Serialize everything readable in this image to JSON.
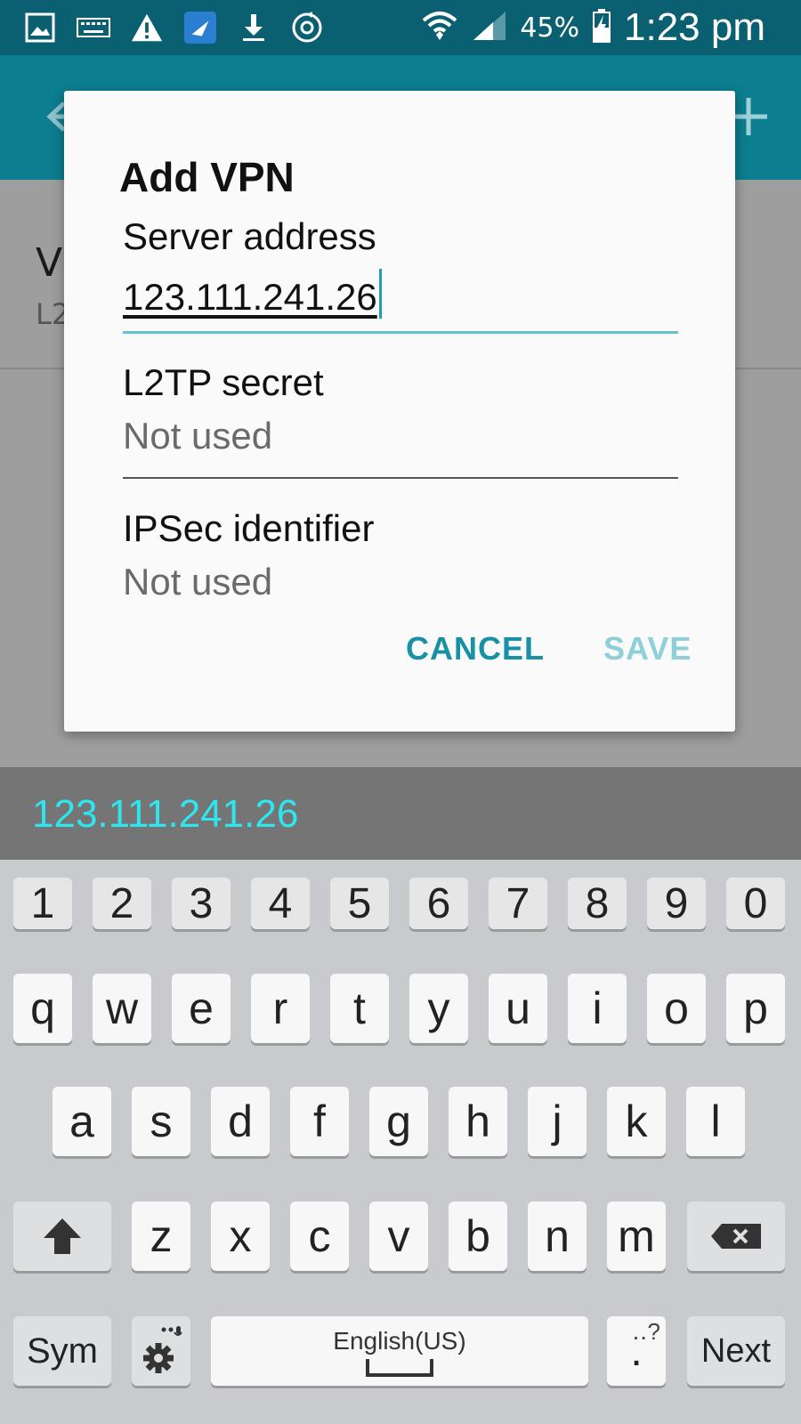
{
  "status_bar": {
    "battery_percent": "45%",
    "time": "1:23 pm",
    "icons_left": [
      "gallery-icon",
      "keyboard-icon",
      "warning-icon",
      "app-icon",
      "download-icon",
      "sync-icon"
    ],
    "icons_right": [
      "wifi-icon",
      "signal-icon",
      "battery-charging-icon"
    ]
  },
  "background": {
    "item_title": "V",
    "item_subtitle": "L2"
  },
  "dialog": {
    "title": "Add VPN",
    "fields": [
      {
        "label": "Server address",
        "value": "123.111.241.26",
        "placeholder": ""
      },
      {
        "label": "L2TP secret",
        "value": "",
        "placeholder": "Not used"
      },
      {
        "label": "IPSec identifier",
        "value": "",
        "placeholder": "Not used"
      }
    ],
    "cancel_label": "CANCEL",
    "save_label": "SAVE"
  },
  "suggestion": "123.111.241.26",
  "keyboard": {
    "numbers": [
      "1",
      "2",
      "3",
      "4",
      "5",
      "6",
      "7",
      "8",
      "9",
      "0"
    ],
    "row1": [
      "q",
      "w",
      "e",
      "r",
      "t",
      "y",
      "u",
      "i",
      "o",
      "p"
    ],
    "row2": [
      "a",
      "s",
      "d",
      "f",
      "g",
      "h",
      "j",
      "k",
      "l"
    ],
    "row3": [
      "z",
      "x",
      "c",
      "v",
      "b",
      "n",
      "m"
    ],
    "sym_label": "Sym",
    "space_label": "English(US)",
    "period_label": ".",
    "period_hint": "‥?",
    "next_label": "Next"
  },
  "colors": {
    "status_bar": "#0a5f70",
    "app_bar": "#0c7e8f",
    "accent": "#1890a6",
    "suggestion_text": "#2de7f0"
  }
}
